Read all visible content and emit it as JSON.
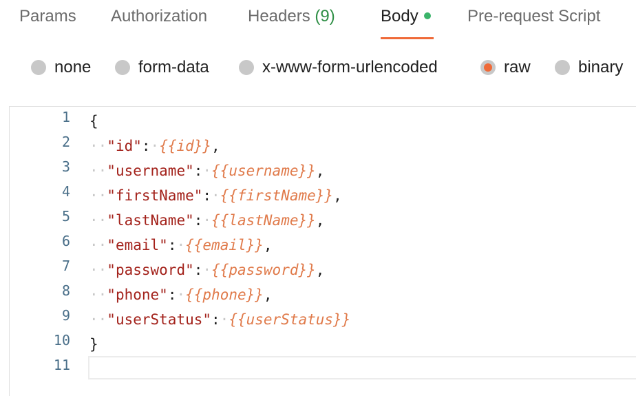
{
  "tabs": [
    {
      "label": "Params",
      "active": false
    },
    {
      "label": "Authorization",
      "active": false
    },
    {
      "label": "Headers",
      "count": "(9)",
      "active": false
    },
    {
      "label": "Body",
      "active": true,
      "indicator_color": "#3bb46a"
    },
    {
      "label": "Pre-request Script",
      "active": false
    }
  ],
  "body_types": [
    {
      "label": "none",
      "selected": false
    },
    {
      "label": "form-data",
      "selected": false
    },
    {
      "label": "x-www-form-urlencoded",
      "selected": false
    },
    {
      "label": "raw",
      "selected": true
    },
    {
      "label": "binary",
      "selected": false
    }
  ],
  "accent_color": "#ef6a38",
  "editor": {
    "line_numbers": [
      "1",
      "2",
      "3",
      "4",
      "5",
      "6",
      "7",
      "8",
      "9",
      "10",
      "11"
    ],
    "open_brace": "{",
    "close_brace": "}",
    "fields": [
      {
        "key": "\"id\"",
        "value": "{{id}}",
        "comma": ","
      },
      {
        "key": "\"username\"",
        "value": "{{username}}",
        "comma": ","
      },
      {
        "key": "\"firstName\"",
        "value": "{{firstName}}",
        "comma": ","
      },
      {
        "key": "\"lastName\"",
        "value": "{{lastName}}",
        "comma": ","
      },
      {
        "key": "\"email\"",
        "value": "{{email}}",
        "comma": ","
      },
      {
        "key": "\"password\"",
        "value": "{{password}}",
        "comma": ","
      },
      {
        "key": "\"phone\"",
        "value": "{{phone}}",
        "comma": ","
      },
      {
        "key": "\"userStatus\"",
        "value": "{{userStatus}}",
        "comma": ""
      }
    ]
  }
}
